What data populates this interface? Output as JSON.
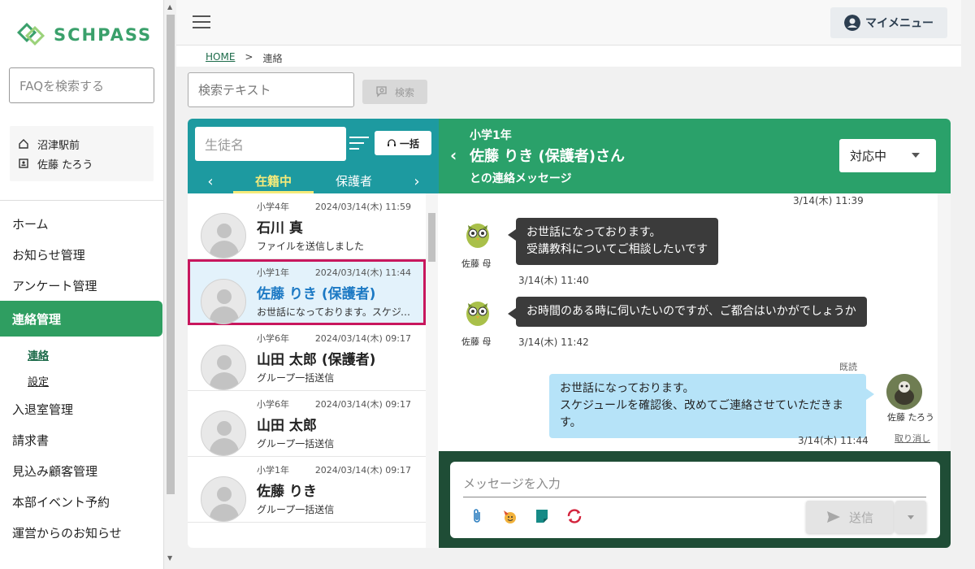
{
  "app": {
    "logo_text": "SCHPASS",
    "faq_placeholder": "FAQを検索する",
    "school_name": "沼津駅前",
    "user_name": "佐藤 たろう"
  },
  "nav": {
    "items": [
      {
        "label": "ホーム"
      },
      {
        "label": "お知らせ管理"
      },
      {
        "label": "アンケート管理"
      },
      {
        "label": "連絡管理"
      },
      {
        "label": "入退室管理"
      },
      {
        "label": "請求書"
      },
      {
        "label": "見込み顧客管理"
      },
      {
        "label": "本部イベント予約"
      },
      {
        "label": "運営からのお知らせ"
      }
    ],
    "sub_items": [
      {
        "label": "連絡"
      },
      {
        "label": "設定"
      }
    ]
  },
  "topbar": {
    "my_menu_label": "マイメニュー"
  },
  "breadcrumb": {
    "home": "HOME",
    "separator": ">",
    "current": "連絡"
  },
  "search": {
    "placeholder": "検索テキスト",
    "button_label": "検索"
  },
  "list": {
    "student_placeholder": "生徒名",
    "bulk_label": "一括",
    "tabs": [
      {
        "label": "在籍中"
      },
      {
        "label": "保護者"
      }
    ],
    "rows": [
      {
        "grade": "小学4年",
        "date": "2024/03/14(木) 11:59",
        "name": "石川 真",
        "message": "ファイルを送信しました"
      },
      {
        "grade": "小学1年",
        "date": "2024/03/14(木) 11:44",
        "name": "佐藤 りき (保護者)",
        "message": "お世話になっております。スケジュー..."
      },
      {
        "grade": "小学6年",
        "date": "2024/03/14(木) 09:17",
        "name": "山田 太郎 (保護者)",
        "message": "グループ一括送信"
      },
      {
        "grade": "小学6年",
        "date": "2024/03/14(木) 09:17",
        "name": "山田 太郎",
        "message": "グループ一括送信"
      },
      {
        "grade": "小学1年",
        "date": "2024/03/14(木) 09:17",
        "name": "佐藤 りき",
        "message": "グループ一括送信"
      }
    ]
  },
  "chat": {
    "grade": "小学1年",
    "title": "佐藤 りき (保護者)さん",
    "subtitle": "との連絡メッセージ",
    "status": "対応中",
    "top_timestamp": "3/14(木) 11:39",
    "messages": [
      {
        "sender": "佐藤 母",
        "line1": "お世話になっております。",
        "line2": "受講教科についてご相談したいです",
        "time": "3/14(木) 11:40"
      },
      {
        "sender": "佐藤 母",
        "line1": "お時間のある時に伺いたいのですが、ご都合はいかがでしょうか",
        "line2": "",
        "time": "3/14(木) 11:42"
      },
      {
        "sender": "佐藤 たろう",
        "line1": "お世話になっております。",
        "line2": "スケジュールを確認後、改めてご連絡させていただきます。",
        "time": "3/14(木) 11:44",
        "read": "既読",
        "unsend": "取り消し"
      }
    ],
    "compose_placeholder": "メッセージを入力",
    "send_label": "送信"
  },
  "colors": {
    "brand_green": "#2f9e61",
    "teal_header": "#1d9aa0",
    "chat_header": "#2aa16a",
    "selected_outline": "#c8175d",
    "compose_bg": "#1f4d36"
  }
}
